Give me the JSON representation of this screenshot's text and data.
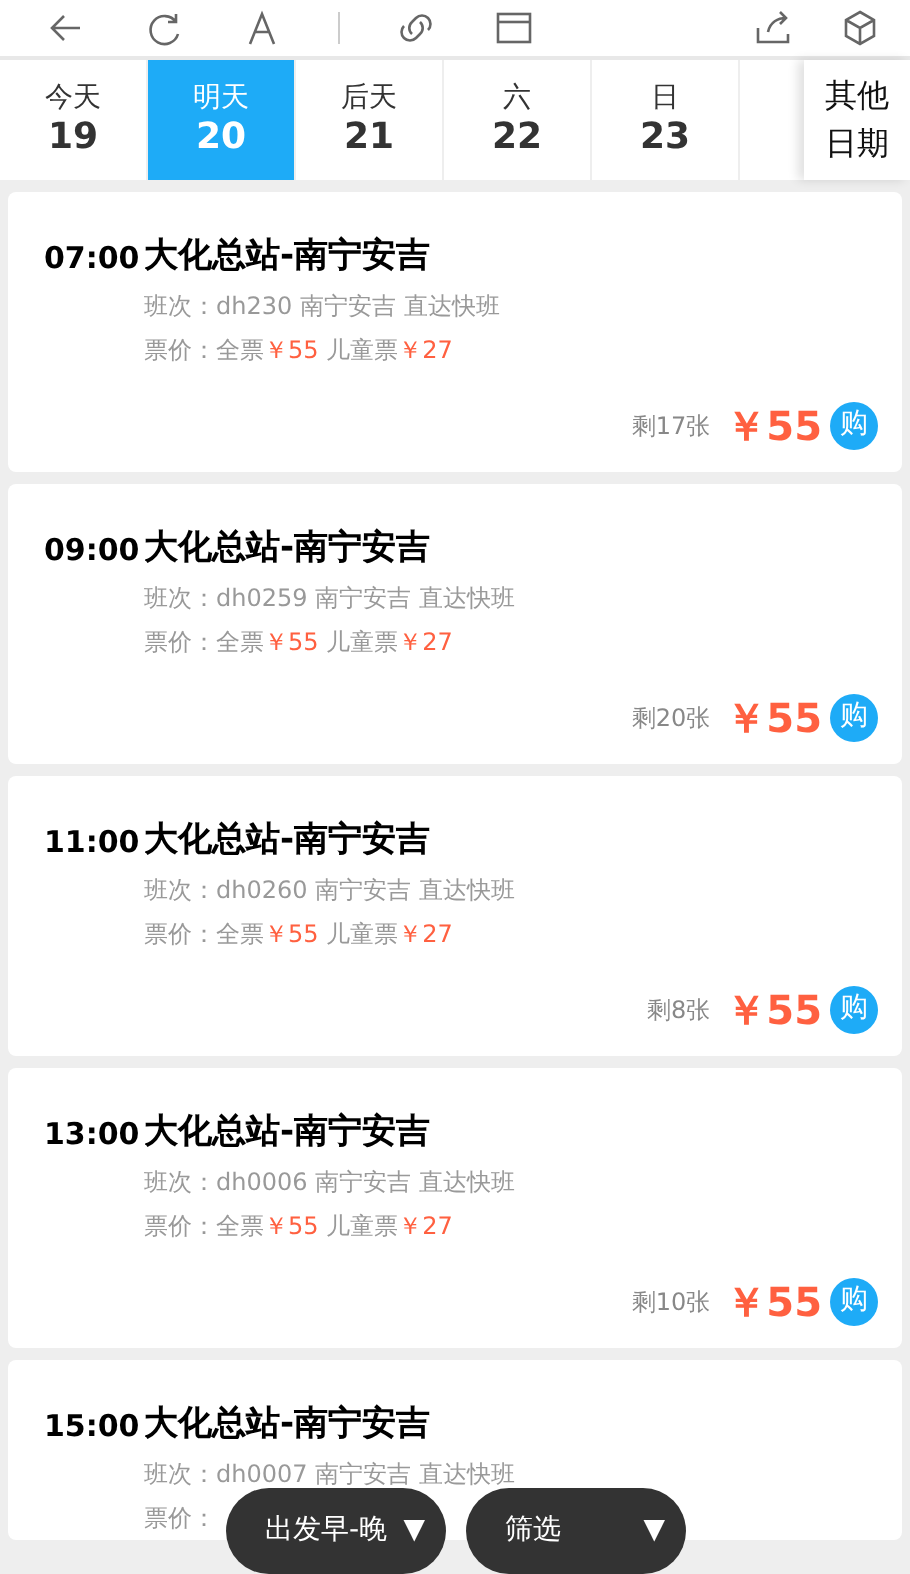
{
  "toolbar": {
    "left": [
      {
        "kind": "back"
      },
      {
        "kind": "refresh"
      },
      {
        "kind": "font"
      },
      {
        "kind": "link"
      },
      {
        "kind": "window"
      }
    ],
    "right": [
      {
        "kind": "share"
      },
      {
        "kind": "cube"
      }
    ]
  },
  "dates": [
    {
      "day": "今天",
      "date": "19",
      "selected": false
    },
    {
      "day": "明天",
      "date": "20",
      "selected": true
    },
    {
      "day": "后天",
      "date": "21",
      "selected": false
    },
    {
      "day": "六",
      "date": "22",
      "selected": false
    },
    {
      "day": "日",
      "date": "23",
      "selected": false
    }
  ],
  "other_dates": "其他日期",
  "trips": [
    {
      "time": "07:00",
      "route": "大化总站-南宁安吉",
      "service": "班次：dh230 南宁安吉 直达快班",
      "fare_label": "票价：全票",
      "full_fare": "￥55",
      "child_label": "儿童票",
      "child_fare": "￥27",
      "remaining": "剩17张",
      "price": "￥55",
      "buy": "购"
    },
    {
      "time": "09:00",
      "route": "大化总站-南宁安吉",
      "service": "班次：dh0259 南宁安吉 直达快班",
      "fare_label": "票价：全票",
      "full_fare": "￥55",
      "child_label": "儿童票",
      "child_fare": "￥27",
      "remaining": "剩20张",
      "price": "￥55",
      "buy": "购"
    },
    {
      "time": "11:00",
      "route": "大化总站-南宁安吉",
      "service": "班次：dh0260 南宁安吉 直达快班",
      "fare_label": "票价：全票",
      "full_fare": "￥55",
      "child_label": "儿童票",
      "child_fare": "￥27",
      "remaining": "剩8张",
      "price": "￥55",
      "buy": "购"
    },
    {
      "time": "13:00",
      "route": "大化总站-南宁安吉",
      "service": "班次：dh0006 南宁安吉 直达快班",
      "fare_label": "票价：全票",
      "full_fare": "￥55",
      "child_label": "儿童票",
      "child_fare": "￥27",
      "remaining": "剩10张",
      "price": "￥55",
      "buy": "购"
    },
    {
      "time": "15:00",
      "route": "大化总站-南宁安吉",
      "service": "班次：dh0007 南宁安吉 直达快班",
      "fare_label": "票价："
    }
  ],
  "bottom_buttons": [
    {
      "label": "出发早-晚",
      "caret": "▼"
    },
    {
      "label": "筛选",
      "caret": "▼"
    }
  ]
}
